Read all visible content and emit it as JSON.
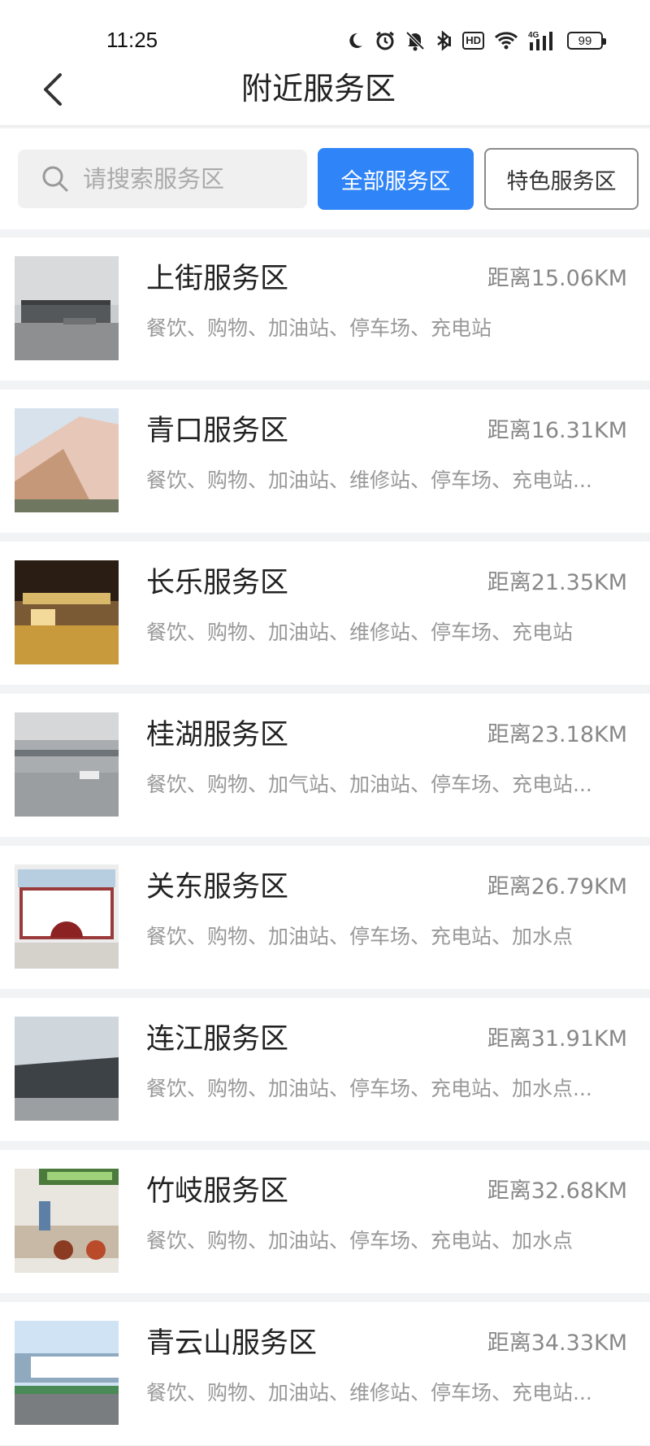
{
  "status_bar": {
    "time": "11:25",
    "network": "4G",
    "battery": "99",
    "hd": "HD"
  },
  "nav": {
    "title": "附近服务区"
  },
  "filters": {
    "search_placeholder": "请搜索服务区",
    "all_label": "全部服务区",
    "special_label": "特色服务区",
    "active": "all",
    "accent_color": "#2f84f8"
  },
  "items": [
    {
      "name": "上街服务区",
      "distance": "距离15.06KM",
      "facilities": "餐饮、购物、加油站、停车场、充电站"
    },
    {
      "name": "青口服务区",
      "distance": "距离16.31KM",
      "facilities": "餐饮、购物、加油站、维修站、停车场、充电站..."
    },
    {
      "name": "长乐服务区",
      "distance": "距离21.35KM",
      "facilities": "餐饮、购物、加油站、维修站、停车场、充电站"
    },
    {
      "name": "桂湖服务区",
      "distance": "距离23.18KM",
      "facilities": "餐饮、购物、加气站、加油站、停车场、充电站..."
    },
    {
      "name": "关东服务区",
      "distance": "距离26.79KM",
      "facilities": "餐饮、购物、加油站、停车场、充电站、加水点"
    },
    {
      "name": "连江服务区",
      "distance": "距离31.91KM",
      "facilities": "餐饮、购物、加油站、停车场、充电站、加水点..."
    },
    {
      "name": "竹岐服务区",
      "distance": "距离32.68KM",
      "facilities": "餐饮、购物、加油站、停车场、充电站、加水点"
    },
    {
      "name": "青云山服务区",
      "distance": "距离34.33KM",
      "facilities": "餐饮、购物、加油站、维修站、停车场、充电站..."
    }
  ]
}
